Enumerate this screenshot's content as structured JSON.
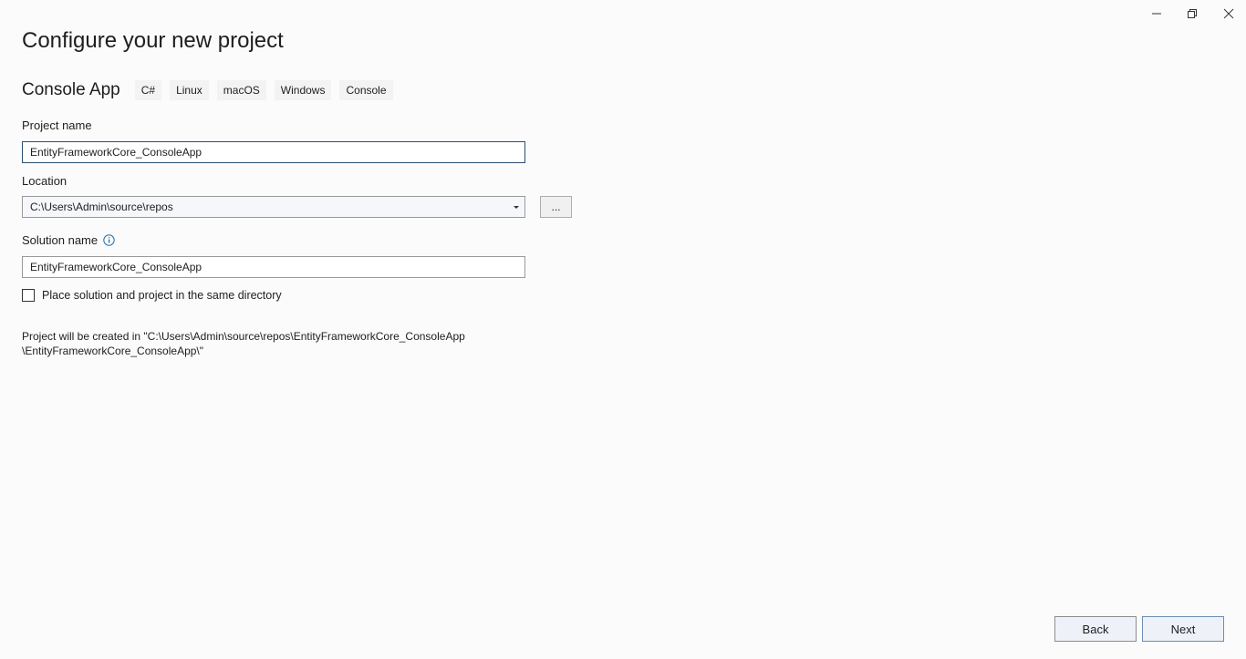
{
  "window_controls": {
    "minimize": "minimize-icon",
    "restore": "restore-icon",
    "close": "close-icon"
  },
  "page": {
    "title": "Configure your new project"
  },
  "template": {
    "name": "Console App",
    "tags": [
      "C#",
      "Linux",
      "macOS",
      "Windows",
      "Console"
    ]
  },
  "form": {
    "project_name_label": "Project name",
    "project_name_value": "EntityFrameworkCore_ConsoleApp",
    "location_label": "Location",
    "location_value": "C:\\Users\\Admin\\source\\repos",
    "browse_label": "...",
    "solution_name_label": "Solution name",
    "solution_name_value": "EntityFrameworkCore_ConsoleApp",
    "same_directory_label": "Place solution and project in the same directory",
    "same_directory_checked": false
  },
  "note": {
    "line1": "Project will be created in \"C:\\Users\\Admin\\source\\repos\\EntityFrameworkCore_ConsoleApp",
    "line2": "\\EntityFrameworkCore_ConsoleApp\\\""
  },
  "footer": {
    "back_label": "Back",
    "next_label": "Next"
  },
  "colors": {
    "background": "#fbfbfb",
    "focused_border": "#2d4e6e",
    "info_icon": "#1a6fb3"
  }
}
